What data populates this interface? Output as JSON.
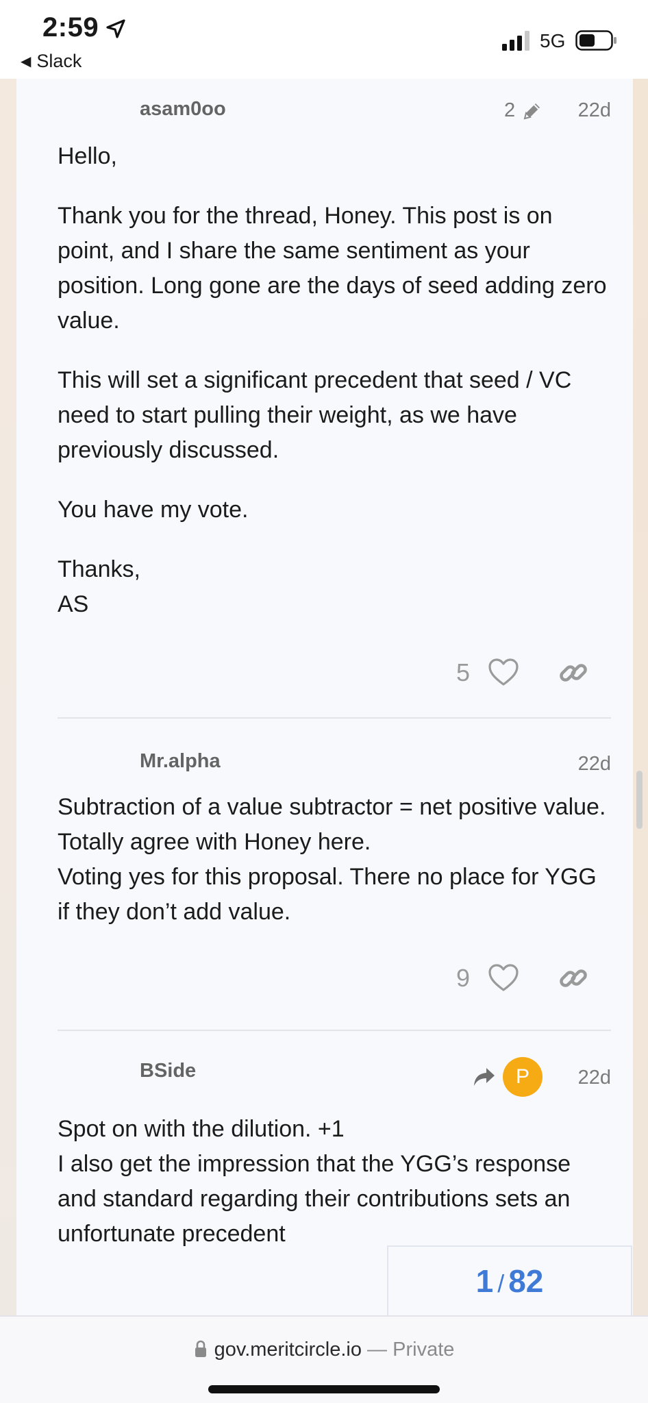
{
  "status_bar": {
    "time": "2:59",
    "back_app": "Slack",
    "network": "5G"
  },
  "posts": [
    {
      "username": "asam0oo",
      "edit_count": "2",
      "age": "22d",
      "paragraphs": [
        "Hello,",
        "Thank you for the thread, Honey. This post is on point, and I share the same sentiment as your position. Long gone are the days of seed adding zero value.",
        "This will set a significant precedent that seed / VC need to start pulling their weight, as we have previously discussed.",
        "You have my vote.",
        "Thanks,\nAS"
      ],
      "likes": "5"
    },
    {
      "username": "Mr.alpha",
      "age": "22d",
      "paragraphs": [
        "Subtraction of a value subtractor = net positive value. Totally agree with Honey here.\nVoting yes for this proposal. There no place for YGG if they don’t add value."
      ],
      "likes": "9"
    },
    {
      "username": "BSide",
      "reply_avatar_letter": "P",
      "age": "22d",
      "paragraphs": [
        "Spot on with the dilution. +1\nI also get the impression that the YGG’s response and standard regarding their contributions sets an unfortunate precedent"
      ]
    }
  ],
  "page_counter": {
    "current": "1",
    "separator": "/",
    "total": "82"
  },
  "browser": {
    "domain": "gov.meritcircle.io",
    "separator": " — ",
    "privacy": "Private"
  },
  "colors": {
    "accent": "#3f7ad6",
    "avatar": "#f6ab15"
  }
}
